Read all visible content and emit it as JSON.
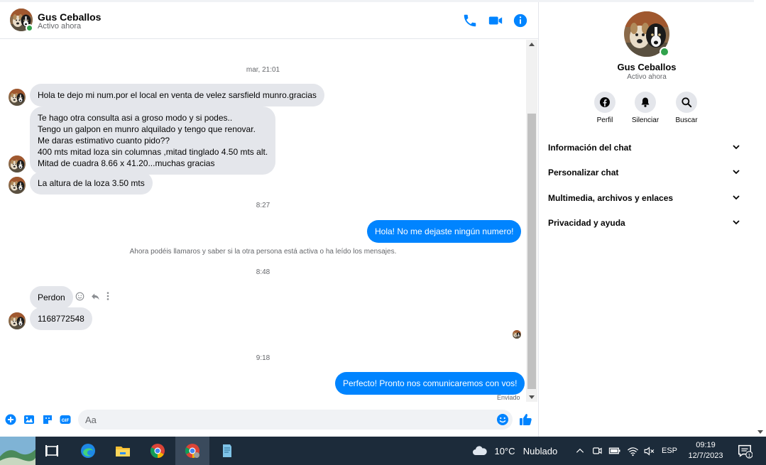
{
  "header": {
    "name": "Gus Ceballos",
    "status": "Activo ahora"
  },
  "chat": {
    "timestamps": [
      "mar, 21:01",
      "8:27",
      "8:48",
      "9:18"
    ],
    "messages": {
      "m1": "Hola te dejo mi num.por el local en venta de velez sarsfield munro.gracias",
      "m2": "Te hago otra consulta asi a groso modo y si podes..\nTengo un galpon en munro alquilado y tengo que renovar.\nMe daras estimativo cuanto pido??\n400 mts mitad loza sin columnas ,mitad tinglado 4.50 mts alt.\nMitad de cuadra 8.66 x 41.20...muchas gracias",
      "m3": "La altura de la loza 3.50 mts",
      "m4": "Hola! No me dejaste ningún numero!",
      "m5": "Perdon",
      "m6": "1168772548",
      "m7": "Perfecto! Pronto nos comunicaremos con vos!"
    },
    "notice": "Ahora podéis llamaros y saber si la otra persona está activa o ha leído los mensajes.",
    "sent_label": "Enviado"
  },
  "composer": {
    "placeholder": "Aa"
  },
  "panel": {
    "name": "Gus Ceballos",
    "status": "Activo ahora",
    "actions": [
      "Perfil",
      "Silenciar",
      "Buscar"
    ],
    "sections": [
      "Información del chat",
      "Personalizar chat",
      "Multimedia, archivos y enlaces",
      "Privacidad y ayuda"
    ]
  },
  "taskbar": {
    "weather": "10°C",
    "weather_desc": "Nublado",
    "lang": "ESP",
    "time": "09:19",
    "date": "12/7/2023",
    "notif_count": "1"
  },
  "colors": {
    "accent": "#0084ff",
    "incoming_bubble": "#e4e6eb",
    "online": "#31a24c",
    "taskbar": "#1c2b3a"
  },
  "icons": [
    "phone-icon",
    "video-icon",
    "info-icon",
    "plus-icon",
    "photo-icon",
    "sticker-icon",
    "gif-icon",
    "emoji-icon",
    "like-icon",
    "facebook-icon",
    "bell-icon",
    "search-icon",
    "chevron-down-icon"
  ]
}
